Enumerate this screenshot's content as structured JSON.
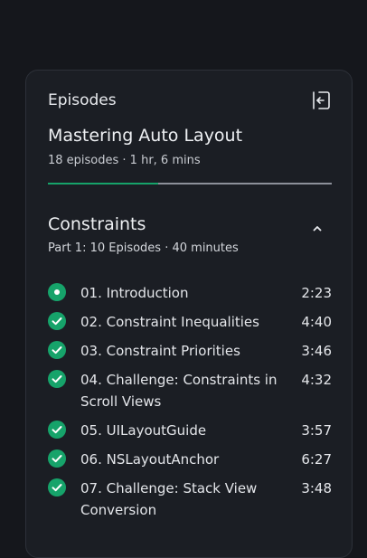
{
  "panel": {
    "header_label": "Episodes",
    "exit_icon": "exit-icon",
    "course_title": "Mastering Auto Layout",
    "course_meta": "18 episodes · 1 hr, 6 mins",
    "progress_fraction": 0.39,
    "accent_color": "#16a36a"
  },
  "section": {
    "title": "Constraints",
    "meta": "Part 1: 10 Episodes · 40 minutes",
    "collapse_icon": "chevron-up-icon"
  },
  "episodes": [
    {
      "title": "01. Introduction",
      "duration": "2:23",
      "status": "in-progress"
    },
    {
      "title": "02. Constraint Inequalities",
      "duration": "4:40",
      "status": "completed"
    },
    {
      "title": "03. Constraint Priorities",
      "duration": "3:46",
      "status": "completed"
    },
    {
      "title": "04. Challenge: Constraints in Scroll Views",
      "duration": "4:32",
      "status": "completed"
    },
    {
      "title": "05. UILayoutGuide",
      "duration": "3:57",
      "status": "completed"
    },
    {
      "title": "06. NSLayoutAnchor",
      "duration": "6:27",
      "status": "completed"
    },
    {
      "title": "07. Challenge: Stack View Conversion",
      "duration": "3:48",
      "status": "completed"
    }
  ]
}
